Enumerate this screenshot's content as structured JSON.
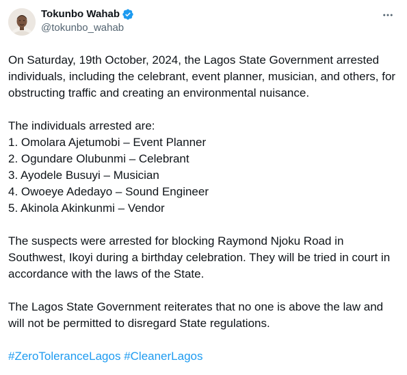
{
  "author": {
    "display_name": "Tokunbo Wahab",
    "handle": "@tokunbo_wahab"
  },
  "colors": {
    "text": "#0f1419",
    "secondary": "#536471",
    "link": "#1d9bf0",
    "verified": "#1d9bf0"
  },
  "icons": {
    "verified": "verified-badge-icon",
    "more": "more-options-icon"
  },
  "tweet": {
    "intro": "On Saturday, 19th October, 2024, the Lagos State Government arrested individuals, including the celebrant, event planner, musician, and others, for obstructing traffic and creating an environmental nuisance.",
    "list_heading": "The individuals arrested are:",
    "arrested": [
      "1. Omolara Ajetumobi – Event Planner",
      "2. Ogundare Olubunmi – Celebrant",
      "3. Ayodele Busuyi – Musician",
      "4. Owoeye Adedayo – Sound Engineer",
      "5. Akinola Akinkunmi – Vendor"
    ],
    "details": "The suspects were arrested for blocking Raymond Njoku Road in Southwest, Ikoyi during a birthday celebration. They will be tried in court in accordance with the laws of the State.",
    "closing": "The Lagos State Government reiterates that no one is above the law and will not be permitted to disregard State regulations.",
    "hashtags": [
      "#ZeroToleranceLagos",
      "#CleanerLagos"
    ]
  }
}
